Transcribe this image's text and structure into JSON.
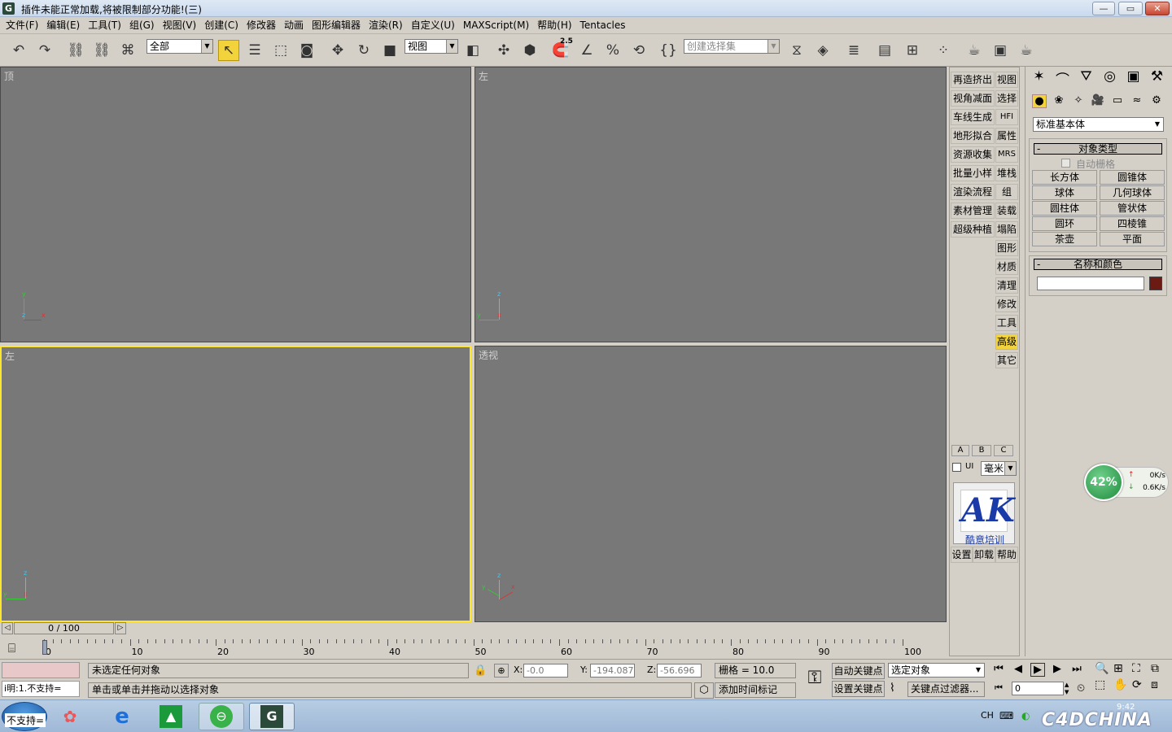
{
  "window": {
    "title": "插件未能正常加载,将被限制部分功能!(三)",
    "minimize": "—",
    "maximize": "▭",
    "close": "✕",
    "app_icon": "G"
  },
  "menu": [
    "文件(F)",
    "编辑(E)",
    "工具(T)",
    "组(G)",
    "视图(V)",
    "创建(C)",
    "修改器",
    "动画",
    "图形编辑器",
    "渲染(R)",
    "自定义(U)",
    "MAXScript(M)",
    "帮助(H)",
    "Tentacles"
  ],
  "toolbar": {
    "selection_filter": "全部",
    "ref_coord": "视图",
    "named_selection_placeholder": "创建选择集",
    "snap_angle": "2.5",
    "accent": "#f2d33c"
  },
  "viewports": [
    {
      "label": "顶",
      "selected": false,
      "axes": "y,z,x"
    },
    {
      "label": "左",
      "selected": false,
      "axes": "z,y,x"
    },
    {
      "label": "左",
      "selected": true,
      "axes": "z,y,x"
    },
    {
      "label": "透视",
      "selected": false,
      "axes": "z,y,x"
    }
  ],
  "plugin_panel": {
    "left_col": [
      "再造挤出",
      "视角减面",
      "车线生成",
      "地形拟合",
      "资源收集",
      "批量小样",
      "渲染流程",
      "素材管理",
      "超级种植"
    ],
    "right_col": [
      "视图",
      "选择",
      "HFI",
      "属性",
      "MRS",
      "堆栈",
      "组",
      "装载",
      "塌陷",
      "图形",
      "材质",
      "清理",
      "修改",
      "工具",
      "高级",
      "其它"
    ],
    "highlighted": "高级",
    "abc": [
      "A",
      "B",
      "C"
    ],
    "ui_label": "UI",
    "unit": "毫米",
    "logo_text": "AK",
    "logo_caption": "酷意培训",
    "bottom": [
      "设置",
      "卸载",
      "帮助"
    ]
  },
  "command_panel": {
    "category": "标准基本体",
    "object_type_header": "对象类型",
    "auto_grid": "自动栅格",
    "objects": [
      "长方体",
      "圆锥体",
      "球体",
      "几何球体",
      "圆柱体",
      "管状体",
      "圆环",
      "四棱锥",
      "茶壶",
      "平面"
    ],
    "name_color_header": "名称和颜色",
    "name_value": "",
    "color": "#6b1a14",
    "collapse_mark": "-"
  },
  "timeline": {
    "position": "0 / 100",
    "ticks": [
      "0",
      "10",
      "20",
      "30",
      "40",
      "50",
      "60",
      "70",
      "80",
      "90",
      "100"
    ]
  },
  "status": {
    "script_listener": "",
    "script_listener_line2": "i明:1.不支持=",
    "prompt1": "未选定任何对象",
    "prompt2": "单击或单击并拖动以选择对象",
    "x_label": "X:",
    "x_value": "-0.0",
    "y_label": "Y:",
    "y_value": "-194.087",
    "z_label": "Z:",
    "z_value": "-56.696",
    "grid": "栅格 = 10.0",
    "add_time_tag": "添加时间标记",
    "auto_key": "自动关键点",
    "set_key": "设置关键点",
    "key_mode": "选定对象",
    "key_filters": "关键点过滤器...",
    "frame": "0"
  },
  "net_widget": {
    "percent": "42%",
    "up": "0K/s",
    "down": "0.6K/s"
  },
  "taskbar": {
    "start": "不支持=",
    "lang": "CH",
    "clock": "9:42",
    "watermark": "C4DCHINA"
  }
}
